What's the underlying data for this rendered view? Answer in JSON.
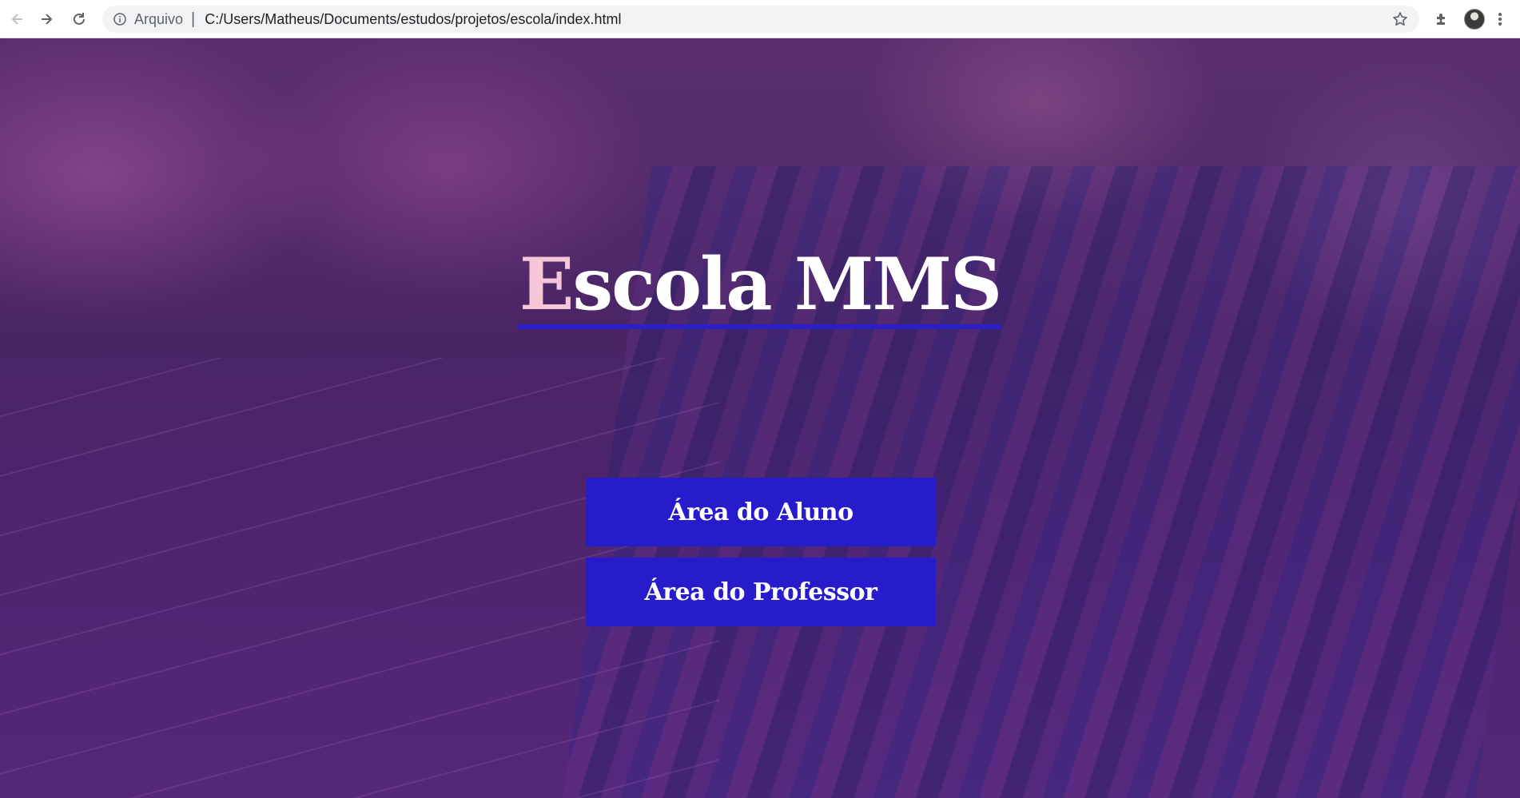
{
  "browser": {
    "site_label": "Arquivo",
    "separator": "|",
    "url": "C:/Users/Matheus/Documents/estudos/projetos/escola/index.html",
    "icons": [
      "back-icon",
      "forward-icon",
      "reload-icon",
      "info-icon",
      "star-icon",
      "extensions-icon",
      "profile-avatar",
      "menu-icon"
    ]
  },
  "hero": {
    "title_first_letter": "E",
    "title_rest": "scola MMS",
    "title_underline_color": "#2a1fc8",
    "first_letter_color": "#f5c6d6"
  },
  "buttons": {
    "aluno_label": "Área do Aluno",
    "professor_label": "Área do Professor",
    "background_color": "#261ccb"
  }
}
